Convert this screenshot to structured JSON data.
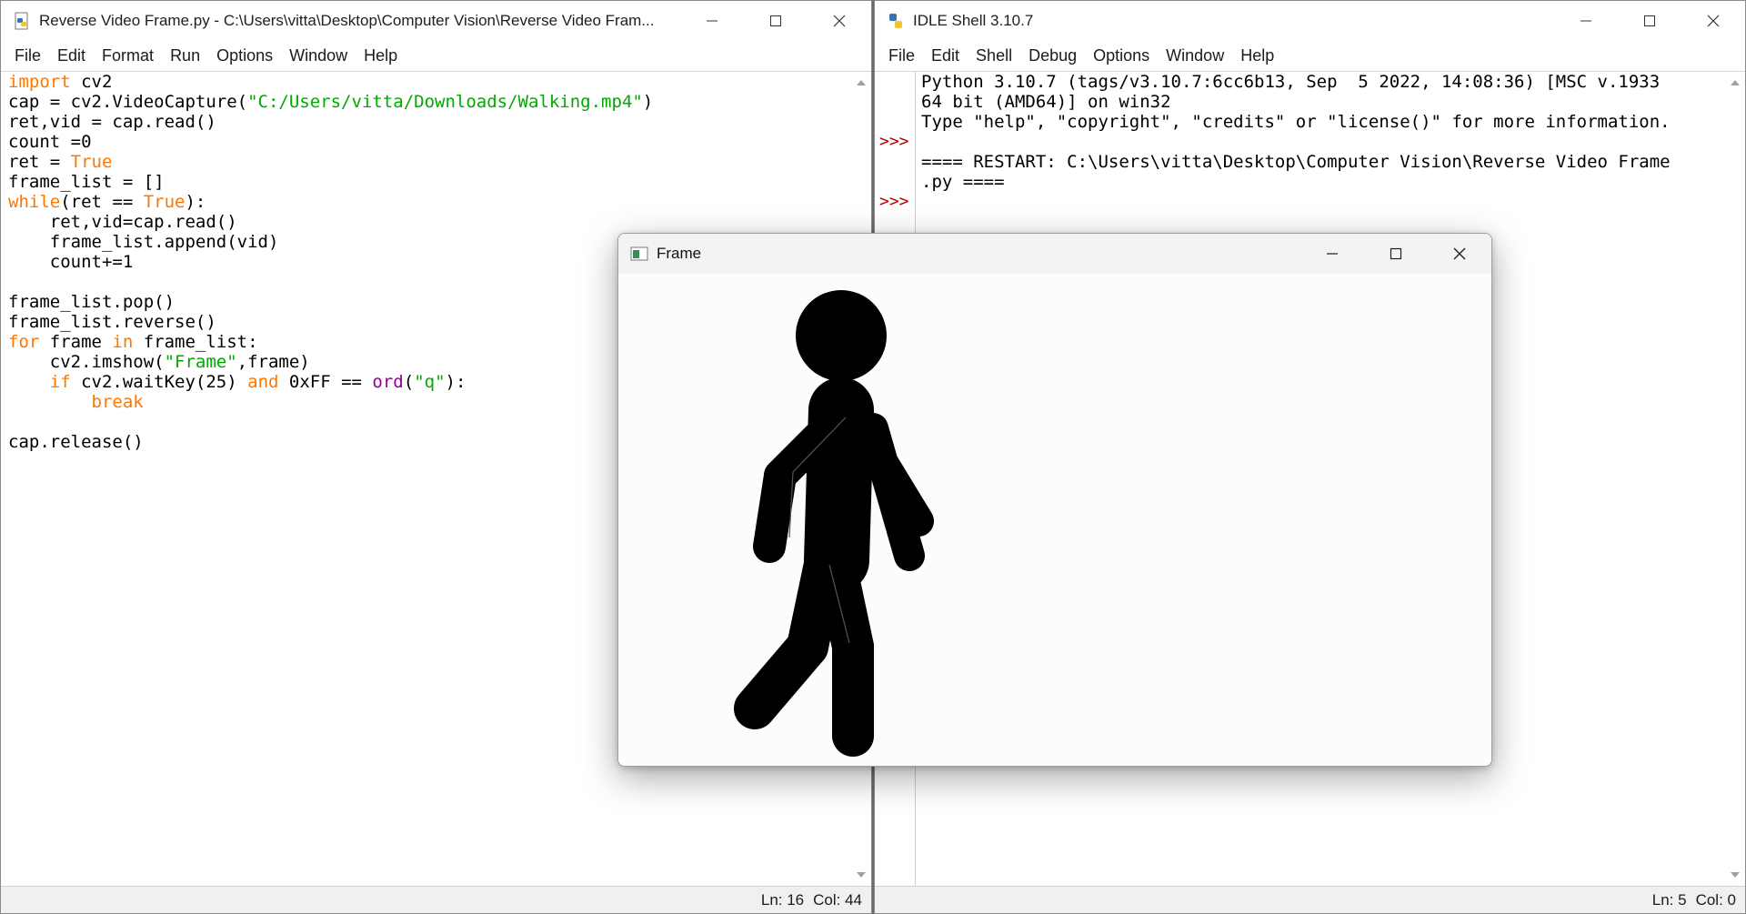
{
  "editor": {
    "title": "Reverse Video Frame.py - C:\\Users\\vitta\\Desktop\\Computer Vision\\Reverse Video Fram...",
    "menu": [
      "File",
      "Edit",
      "Format",
      "Run",
      "Options",
      "Window",
      "Help"
    ],
    "code": [
      [
        {
          "t": "import",
          "c": "kw"
        },
        {
          "t": " cv2"
        }
      ],
      [
        {
          "t": "cap = cv2.VideoCapture("
        },
        {
          "t": "\"C:/Users/vitta/Downloads/Walking.mp4\"",
          "c": "str"
        },
        {
          "t": ")"
        }
      ],
      [
        {
          "t": "ret,vid = cap.read()"
        }
      ],
      [
        {
          "t": "count =0"
        }
      ],
      [
        {
          "t": "ret = "
        },
        {
          "t": "True",
          "c": "kw"
        }
      ],
      [
        {
          "t": "frame_list = []"
        }
      ],
      [
        {
          "t": "while",
          "c": "kw"
        },
        {
          "t": "(ret == "
        },
        {
          "t": "True",
          "c": "kw"
        },
        {
          "t": "):"
        }
      ],
      [
        {
          "t": "    ret,vid=cap.read()"
        }
      ],
      [
        {
          "t": "    frame_list.append(vid)"
        }
      ],
      [
        {
          "t": "    count+=1"
        }
      ],
      [
        {
          "t": ""
        }
      ],
      [
        {
          "t": "frame_list.pop()"
        }
      ],
      [
        {
          "t": "frame_list.reverse()"
        }
      ],
      [
        {
          "t": "for",
          "c": "kw"
        },
        {
          "t": " frame "
        },
        {
          "t": "in",
          "c": "kw"
        },
        {
          "t": " frame_list:"
        }
      ],
      [
        {
          "t": "    cv2.imshow("
        },
        {
          "t": "\"Frame\"",
          "c": "str"
        },
        {
          "t": ",frame)"
        }
      ],
      [
        {
          "t": "    "
        },
        {
          "t": "if",
          "c": "kw"
        },
        {
          "t": " cv2.waitKey(25) "
        },
        {
          "t": "and",
          "c": "kw"
        },
        {
          "t": " 0xFF == "
        },
        {
          "t": "ord",
          "c": "bi"
        },
        {
          "t": "("
        },
        {
          "t": "\"q\"",
          "c": "str"
        },
        {
          "t": "):"
        }
      ],
      [
        {
          "t": "        "
        },
        {
          "t": "break",
          "c": "kw"
        }
      ],
      [
        {
          "t": ""
        }
      ],
      [
        {
          "t": "cap.release()"
        }
      ]
    ],
    "status_ln": "Ln: 16",
    "status_col": "Col: 44"
  },
  "shell": {
    "title": "IDLE Shell 3.10.7",
    "menu": [
      "File",
      "Edit",
      "Shell",
      "Debug",
      "Options",
      "Window",
      "Help"
    ],
    "lines": [
      "Python 3.10.7 (tags/v3.10.7:6cc6b13, Sep  5 2022, 14:08:36) [MSC v.1933",
      "64 bit (AMD64)] on win32",
      "Type \"help\", \"copyright\", \"credits\" or \"license()\" for more information.",
      "",
      "==== RESTART: C:\\Users\\vitta\\Desktop\\Computer Vision\\Reverse Video Frame",
      ".py ===="
    ],
    "prompt": ">>>",
    "status_ln": "Ln: 5",
    "status_col": "Col: 0"
  },
  "frame": {
    "title": "Frame"
  }
}
